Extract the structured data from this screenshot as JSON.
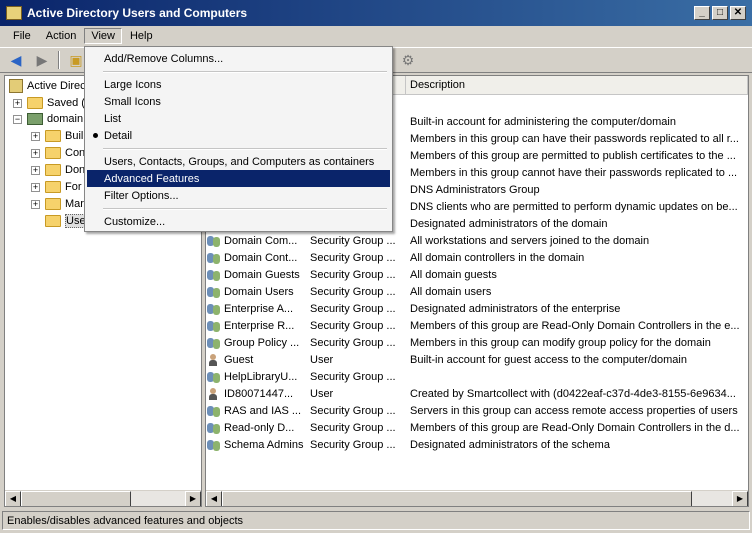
{
  "window": {
    "title": "Active Directory Users and Computers"
  },
  "menubar": {
    "file": "File",
    "action": "Action",
    "view": "View",
    "help": "Help"
  },
  "view_menu": {
    "add_remove_columns": "Add/Remove Columns...",
    "large_icons": "Large Icons",
    "small_icons": "Small Icons",
    "list": "List",
    "detail": "Detail",
    "users_contacts": "Users, Contacts, Groups, and Computers as containers",
    "advanced_features": "Advanced Features",
    "filter_options": "Filter Options...",
    "customize": "Customize..."
  },
  "tree": {
    "root": "Active Directo",
    "saved": "Saved (",
    "domain": "domain",
    "children": [
      "Buil",
      "Con",
      "Don",
      "For",
      "Mar",
      "Use"
    ]
  },
  "list": {
    "columns": {
      "description": "Description"
    },
    "rows": [
      {
        "name": "",
        "type": "",
        "desc": "Built-in account for administering the computer/domain",
        "icon": "user"
      },
      {
        "name": "",
        "type": "",
        "desc": "Members in this group can have their passwords replicated to all r...",
        "icon": "group"
      },
      {
        "name": "",
        "type": "",
        "desc": "Members of this group are permitted to publish certificates to the ...",
        "icon": "group"
      },
      {
        "name": "",
        "type": "",
        "desc": "Members in this group cannot have their passwords replicated to ...",
        "icon": "group"
      },
      {
        "name": "",
        "type": "",
        "desc": "DNS Administrators Group",
        "icon": "group"
      },
      {
        "name": "",
        "type": "",
        "desc": "DNS clients who are permitted to perform dynamic updates on be...",
        "icon": "group"
      },
      {
        "name": "",
        "type": "",
        "desc": "Designated administrators of the domain",
        "icon": "group"
      },
      {
        "name": "Domain Com...",
        "type": "Security Group ...",
        "desc": "All workstations and servers joined to the domain",
        "icon": "group"
      },
      {
        "name": "Domain Cont...",
        "type": "Security Group ...",
        "desc": "All domain controllers in the domain",
        "icon": "group"
      },
      {
        "name": "Domain Guests",
        "type": "Security Group ...",
        "desc": "All domain guests",
        "icon": "group"
      },
      {
        "name": "Domain Users",
        "type": "Security Group ...",
        "desc": "All domain users",
        "icon": "group"
      },
      {
        "name": "Enterprise A...",
        "type": "Security Group ...",
        "desc": "Designated administrators of the enterprise",
        "icon": "group"
      },
      {
        "name": "Enterprise R...",
        "type": "Security Group ...",
        "desc": "Members of this group are Read-Only Domain Controllers in the e...",
        "icon": "group"
      },
      {
        "name": "Group Policy ...",
        "type": "Security Group ...",
        "desc": "Members in this group can modify group policy for the domain",
        "icon": "group"
      },
      {
        "name": "Guest",
        "type": "User",
        "desc": "Built-in account for guest access to the computer/domain",
        "icon": "user"
      },
      {
        "name": "HelpLibraryU...",
        "type": "Security Group ...",
        "desc": "",
        "icon": "group"
      },
      {
        "name": "ID80071447...",
        "type": "User",
        "desc": "Created by Smartcollect with (d0422eaf-c37d-4de3-8155-6e9634...",
        "icon": "user"
      },
      {
        "name": "RAS and IAS ...",
        "type": "Security Group ...",
        "desc": "Servers in this group can access remote access properties of users",
        "icon": "group"
      },
      {
        "name": "Read-only D...",
        "type": "Security Group ...",
        "desc": "Members of this group are Read-Only Domain Controllers in the d...",
        "icon": "group"
      },
      {
        "name": "Schema Admins",
        "type": "Security Group ...",
        "desc": "Designated administrators of the schema",
        "icon": "group"
      }
    ]
  },
  "statusbar": {
    "text": "Enables/disables advanced features and objects"
  }
}
